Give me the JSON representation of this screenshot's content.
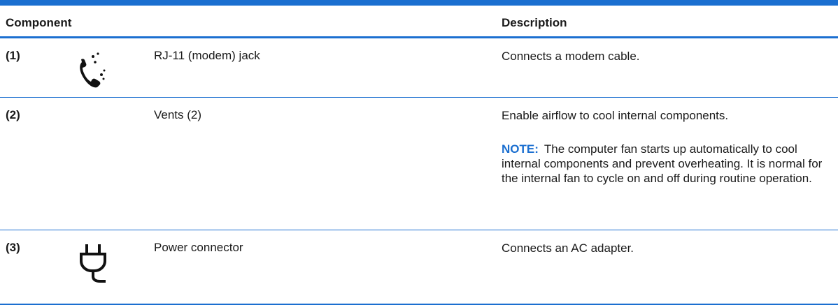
{
  "header": {
    "component": "Component",
    "description": "Description"
  },
  "rows": [
    {
      "number": "(1)",
      "icon": "phone-icon",
      "name": "RJ-11 (modem) jack",
      "description": "Connects a modem cable."
    },
    {
      "number": "(2)",
      "icon": "",
      "name": "Vents (2)",
      "description": "Enable airflow to cool internal components.",
      "note_label": "NOTE:",
      "note_text": "The computer fan starts up automatically to cool internal components and prevent overheating. It is normal for the internal fan to cycle on and off during routine operation."
    },
    {
      "number": "(3)",
      "icon": "power-plug-icon",
      "name": "Power connector",
      "description": "Connects an AC adapter."
    }
  ],
  "colors": {
    "accent": "#1b6fd0",
    "text": "#1a1a1a"
  }
}
